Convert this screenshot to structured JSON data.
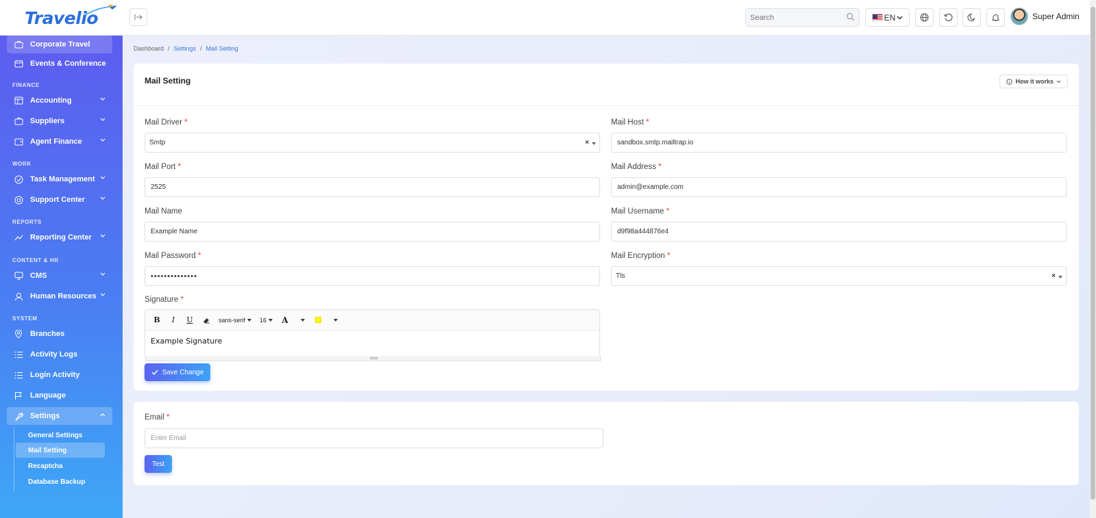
{
  "brand": {
    "name": "Travelio"
  },
  "header": {
    "search_placeholder": "Search",
    "language": "EN",
    "user_name": "Super Admin"
  },
  "sidebar": {
    "items": [
      {
        "label": "Corporate Travel",
        "icon": "briefcase-icon"
      },
      {
        "label": "Events & Conference",
        "icon": "calendar-icon"
      },
      {
        "label": "Accounting",
        "icon": "ledger-icon"
      },
      {
        "label": "Suppliers",
        "icon": "briefcase-icon"
      },
      {
        "label": "Agent Finance",
        "icon": "wallet-icon"
      },
      {
        "label": "Task Management",
        "icon": "check-circle-icon"
      },
      {
        "label": "Support Center",
        "icon": "lifebuoy-icon"
      },
      {
        "label": "Reporting Center",
        "icon": "chart-line-icon"
      },
      {
        "label": "CMS",
        "icon": "monitor-icon"
      },
      {
        "label": "Human Resources",
        "icon": "users-icon"
      },
      {
        "label": "Branches",
        "icon": "map-pin-icon"
      },
      {
        "label": "Activity Logs",
        "icon": "list-icon"
      },
      {
        "label": "Login Activity",
        "icon": "list-icon"
      },
      {
        "label": "Language",
        "icon": "flag-icon"
      },
      {
        "label": "Settings",
        "icon": "wrench-icon"
      }
    ],
    "sections": [
      "FINANCE",
      "WORK",
      "REPORTS",
      "CONTENT & HR",
      "SYSTEM"
    ],
    "settings_sub": [
      "General Settings",
      "Mail Setting",
      "Recaptcha",
      "Database Backup"
    ]
  },
  "breadcrumb": [
    "Dashboard",
    "Settings",
    "Mail Setting"
  ],
  "mail_card": {
    "title": "Mail Setting",
    "how_it_works": "How it works",
    "fields": {
      "mail_driver": {
        "label": "Mail Driver",
        "value": "Smtp"
      },
      "mail_host": {
        "label": "Mail Host",
        "value": "sandbox.smtp.mailtrap.io"
      },
      "mail_port": {
        "label": "Mail Port",
        "value": "2525"
      },
      "mail_address": {
        "label": "Mail Address",
        "value": "admin@example.com"
      },
      "mail_name": {
        "label": "Mail Name",
        "value": "Example Name"
      },
      "mail_username": {
        "label": "Mail Username",
        "value": "d9f98a444876e4"
      },
      "mail_password": {
        "label": "Mail Password",
        "value": "••••••••••••••"
      },
      "mail_encryption": {
        "label": "Mail Encryption",
        "value": "Tls"
      },
      "signature": {
        "label": "Signature",
        "value": "Example Signature"
      }
    },
    "editor": {
      "font": "sans-serif",
      "size": "16"
    },
    "save_label": "Save Change",
    "required_mark": "*"
  },
  "test_card": {
    "email_label": "Email",
    "email_placeholder": "Enter Email",
    "test_label": "Test"
  },
  "colors": {
    "primary": "#4a7ef2",
    "accent": "#3ca2f5",
    "required": "#e53935"
  }
}
